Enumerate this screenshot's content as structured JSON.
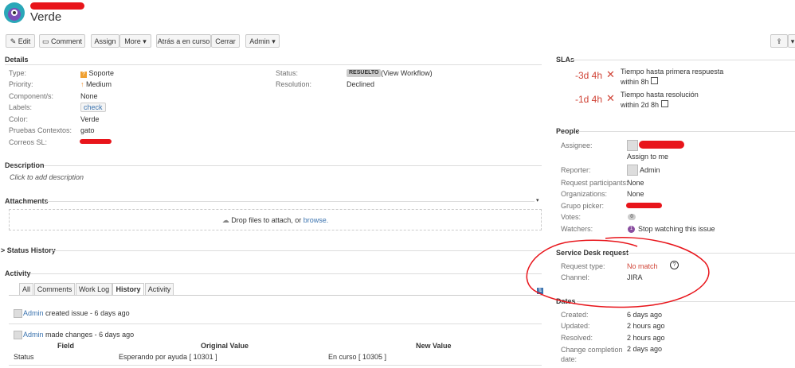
{
  "issue": {
    "title": "Verde"
  },
  "toolbar": {
    "edit": "Edit",
    "comment": "Comment",
    "assign": "Assign",
    "more": "More",
    "back_in_progress": "Atrás a en curso",
    "close": "Cerrar",
    "admin": "Admin"
  },
  "details": {
    "heading": "Details",
    "left": [
      {
        "label": "Type:",
        "value": "Soporte"
      },
      {
        "label": "Priority:",
        "value": "Medium"
      },
      {
        "label": "Component/s:",
        "value": "None"
      },
      {
        "label": "Labels:",
        "value": "check"
      },
      {
        "label": "Color:",
        "value": "Verde"
      },
      {
        "label": "Pruebas Contextos:",
        "value": "gato"
      },
      {
        "label": "Correos SL:",
        "value": ""
      }
    ],
    "status_label": "Status:",
    "status_value": "RESUELTO",
    "view_workflow": "(View Workflow)",
    "resolution_label": "Resolution:",
    "resolution_value": "Declined"
  },
  "description": {
    "heading": "Description",
    "placeholder": "Click to add description"
  },
  "attachments": {
    "heading": "Attachments",
    "drop_text": "Drop files to attach, or",
    "browse": "browse."
  },
  "status_history": {
    "heading": "Status History"
  },
  "activity": {
    "heading": "Activity",
    "tabs": [
      "All",
      "Comments",
      "Work Log",
      "History",
      "Activity"
    ],
    "entries": [
      {
        "user": "Admin",
        "text": "created issue - 6 days ago"
      },
      {
        "user": "Admin",
        "text": "made changes - 6 days ago"
      }
    ],
    "table": {
      "headers": [
        "Field",
        "Original Value",
        "New Value"
      ],
      "row": [
        "Status",
        "Esperando por ayuda [ 10301 ]",
        "En curso [ 10305 ]"
      ]
    }
  },
  "slas": {
    "heading": "SLAs",
    "items": [
      {
        "time": "-3d 4h",
        "name": "Tiempo hasta primera respuesta",
        "goal": "within 8h"
      },
      {
        "time": "-1d 4h",
        "name": "Tiempo hasta resolución",
        "goal": "within 2d 8h"
      }
    ]
  },
  "people": {
    "heading": "People",
    "assignee_label": "Assignee:",
    "assign_to_me": "Assign to me",
    "reporter_label": "Reporter:",
    "reporter_value": "Admin",
    "participants_label": "Request participants:",
    "participants_value": "None",
    "organizations_label": "Organizations:",
    "organizations_value": "None",
    "grupo_label": "Grupo picker:",
    "votes_label": "Votes:",
    "votes_value": "0",
    "watchers_label": "Watchers:",
    "watchers_count": "1",
    "stop_watching": "Stop watching this issue"
  },
  "service_desk": {
    "heading": "Service Desk request",
    "request_type_label": "Request type:",
    "request_type_value": "No match",
    "channel_label": "Channel:",
    "channel_value": "JIRA"
  },
  "dates": {
    "heading": "Dates",
    "items": [
      {
        "label": "Created:",
        "value": "6 days ago"
      },
      {
        "label": "Updated:",
        "value": "2 hours ago"
      },
      {
        "label": "Resolved:",
        "value": "2 hours ago"
      },
      {
        "label": "Change completion date:",
        "value": "2 days ago"
      }
    ]
  },
  "colors": {
    "link": "#3b73af",
    "sla_breached": "#d04437",
    "annotation": "#e8151b"
  }
}
